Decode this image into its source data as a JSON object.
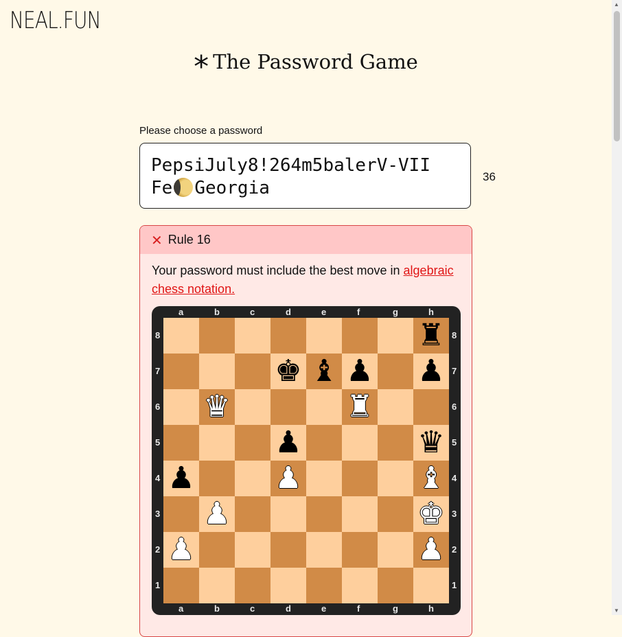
{
  "site": {
    "logo": "NEAL.FUN"
  },
  "game": {
    "title": "The Password Game",
    "star": "*"
  },
  "password": {
    "label": "Please choose a password",
    "line1": "PepsiJuly8!264m5balerV-VII",
    "before_moon": "Fe",
    "after_moon": "Georgia",
    "moon_icon": "waxing-crescent-moon-emoji",
    "length": "36"
  },
  "rule": {
    "title": "Rule 16",
    "status_icon": "x-icon",
    "text_prefix": "Your password must include the best move in ",
    "link_text": "algebraic chess notation.",
    "colors": {
      "border": "#d84646",
      "header": "#ffc7c7",
      "body": "#ffe9e6",
      "link": "#e01515"
    }
  },
  "chess": {
    "files": [
      "a",
      "b",
      "c",
      "d",
      "e",
      "f",
      "g",
      "h"
    ],
    "ranks": [
      "8",
      "7",
      "6",
      "5",
      "4",
      "3",
      "2",
      "1"
    ],
    "light_square": "#fecf9d",
    "dark_square": "#d18b47",
    "rows": [
      [
        "",
        "",
        "",
        "",
        "",
        "",
        "",
        "bR"
      ],
      [
        "",
        "",
        "",
        "bK",
        "bB",
        "bP",
        "",
        "bP"
      ],
      [
        "",
        "wQ",
        "",
        "",
        "",
        "wR",
        "",
        ""
      ],
      [
        "",
        "",
        "",
        "bP",
        "",
        "",
        "",
        "bQ"
      ],
      [
        "bP",
        "",
        "",
        "wP",
        "",
        "",
        "",
        "wB"
      ],
      [
        "",
        "wP",
        "",
        "",
        "",
        "",
        "",
        "wK"
      ],
      [
        "wP",
        "",
        "",
        "",
        "",
        "",
        "",
        "wP"
      ],
      [
        "",
        "",
        "",
        "",
        "",
        "",
        "",
        ""
      ]
    ]
  }
}
